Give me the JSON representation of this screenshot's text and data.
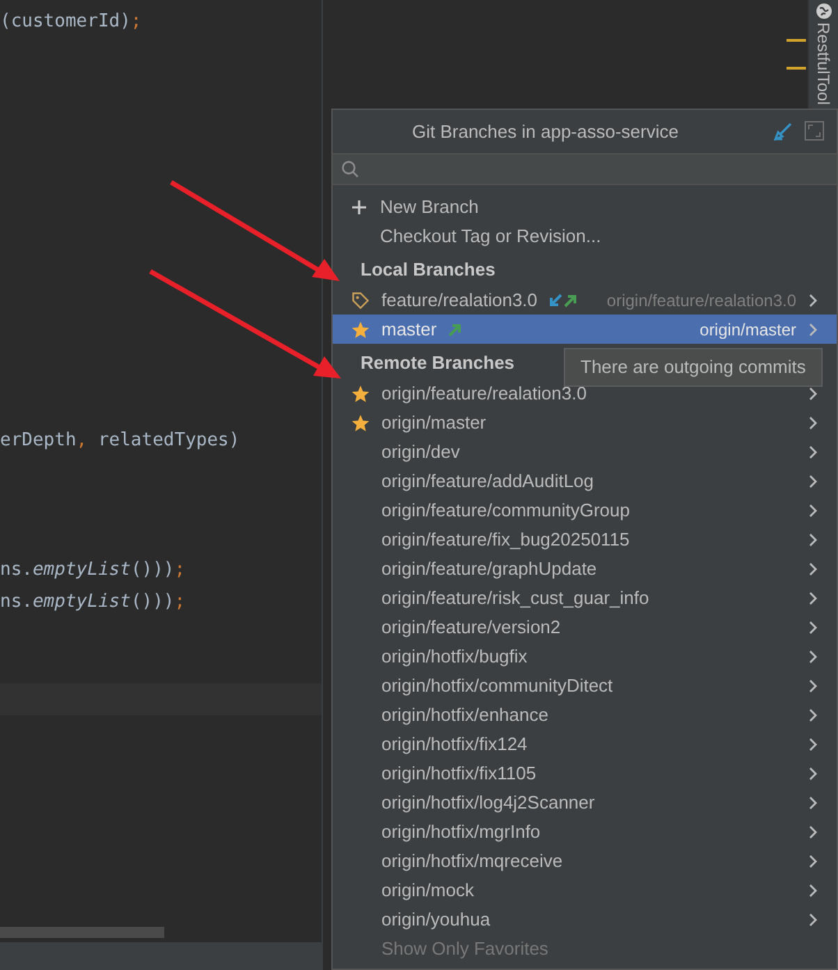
{
  "editor": {
    "lines": [
      {
        "kind": "code",
        "tokens": [
          {
            "kind": "plain",
            "text": "(customerId)"
          },
          {
            "kind": "punct",
            "text": ";"
          }
        ]
      },
      {
        "kind": "blank"
      },
      {
        "kind": "blank"
      },
      {
        "kind": "blank"
      },
      {
        "kind": "blank"
      },
      {
        "kind": "blank"
      },
      {
        "kind": "blank"
      },
      {
        "kind": "blank"
      },
      {
        "kind": "blank"
      },
      {
        "kind": "blank"
      },
      {
        "kind": "blank"
      },
      {
        "kind": "blank"
      },
      {
        "kind": "blank"
      },
      {
        "kind": "code",
        "tokens": [
          {
            "kind": "plain",
            "text": "erDepth"
          },
          {
            "kind": "punct",
            "text": ", "
          },
          {
            "kind": "plain",
            "text": "relatedTypes)"
          }
        ]
      },
      {
        "kind": "blank"
      },
      {
        "kind": "blank"
      },
      {
        "kind": "blank"
      },
      {
        "kind": "code",
        "tokens": [
          {
            "kind": "plain",
            "text": "ns."
          },
          {
            "kind": "italic",
            "text": "emptyList"
          },
          {
            "kind": "plain",
            "text": "()))"
          },
          {
            "kind": "punct",
            "text": ";"
          }
        ]
      },
      {
        "kind": "code",
        "tokens": [
          {
            "kind": "plain",
            "text": "ns."
          },
          {
            "kind": "italic",
            "text": "emptyList"
          },
          {
            "kind": "plain",
            "text": "()))"
          },
          {
            "kind": "punct",
            "text": ";"
          }
        ]
      },
      {
        "kind": "blank"
      },
      {
        "kind": "blank"
      },
      {
        "kind": "current"
      }
    ]
  },
  "side_tool": {
    "label": "RestfulTool"
  },
  "popup": {
    "title": "Git Branches in app-asso-service",
    "actions": [
      {
        "label": "New Branch",
        "kind": "new"
      },
      {
        "label": "Checkout Tag or Revision...",
        "kind": "plain"
      }
    ],
    "local": {
      "heading": "Local Branches",
      "items": [
        {
          "name": "feature/realation3.0",
          "current": true,
          "favorite": false,
          "incoming": true,
          "outgoing": true,
          "tracking": "origin/feature/realation3.0",
          "selected": false
        },
        {
          "name": "master",
          "current": false,
          "favorite": true,
          "incoming": false,
          "outgoing": true,
          "tracking": "origin/master",
          "selected": true
        }
      ]
    },
    "remote": {
      "heading": "Remote Branches",
      "items": [
        {
          "name": "origin/feature/realation3.0",
          "favorite": true
        },
        {
          "name": "origin/master",
          "favorite": true
        },
        {
          "name": "origin/dev",
          "favorite": false
        },
        {
          "name": "origin/feature/addAuditLog",
          "favorite": false
        },
        {
          "name": "origin/feature/communityGroup",
          "favorite": false
        },
        {
          "name": "origin/feature/fix_bug20250115",
          "favorite": false
        },
        {
          "name": "origin/feature/graphUpdate",
          "favorite": false
        },
        {
          "name": "origin/feature/risk_cust_guar_info",
          "favorite": false
        },
        {
          "name": "origin/feature/version2",
          "favorite": false
        },
        {
          "name": "origin/hotfix/bugfix",
          "favorite": false
        },
        {
          "name": "origin/hotfix/communityDitect",
          "favorite": false
        },
        {
          "name": "origin/hotfix/enhance",
          "favorite": false
        },
        {
          "name": "origin/hotfix/fix124",
          "favorite": false
        },
        {
          "name": "origin/hotfix/fix1105",
          "favorite": false
        },
        {
          "name": "origin/hotfix/log4j2Scanner",
          "favorite": false
        },
        {
          "name": "origin/hotfix/mgrInfo",
          "favorite": false
        },
        {
          "name": "origin/hotfix/mqreceive",
          "favorite": false
        },
        {
          "name": "origin/mock",
          "favorite": false
        },
        {
          "name": "origin/youhua",
          "favorite": false
        }
      ]
    },
    "footer": {
      "label": "Show Only Favorites"
    },
    "tooltip": {
      "text": "There are outgoing commits"
    }
  }
}
